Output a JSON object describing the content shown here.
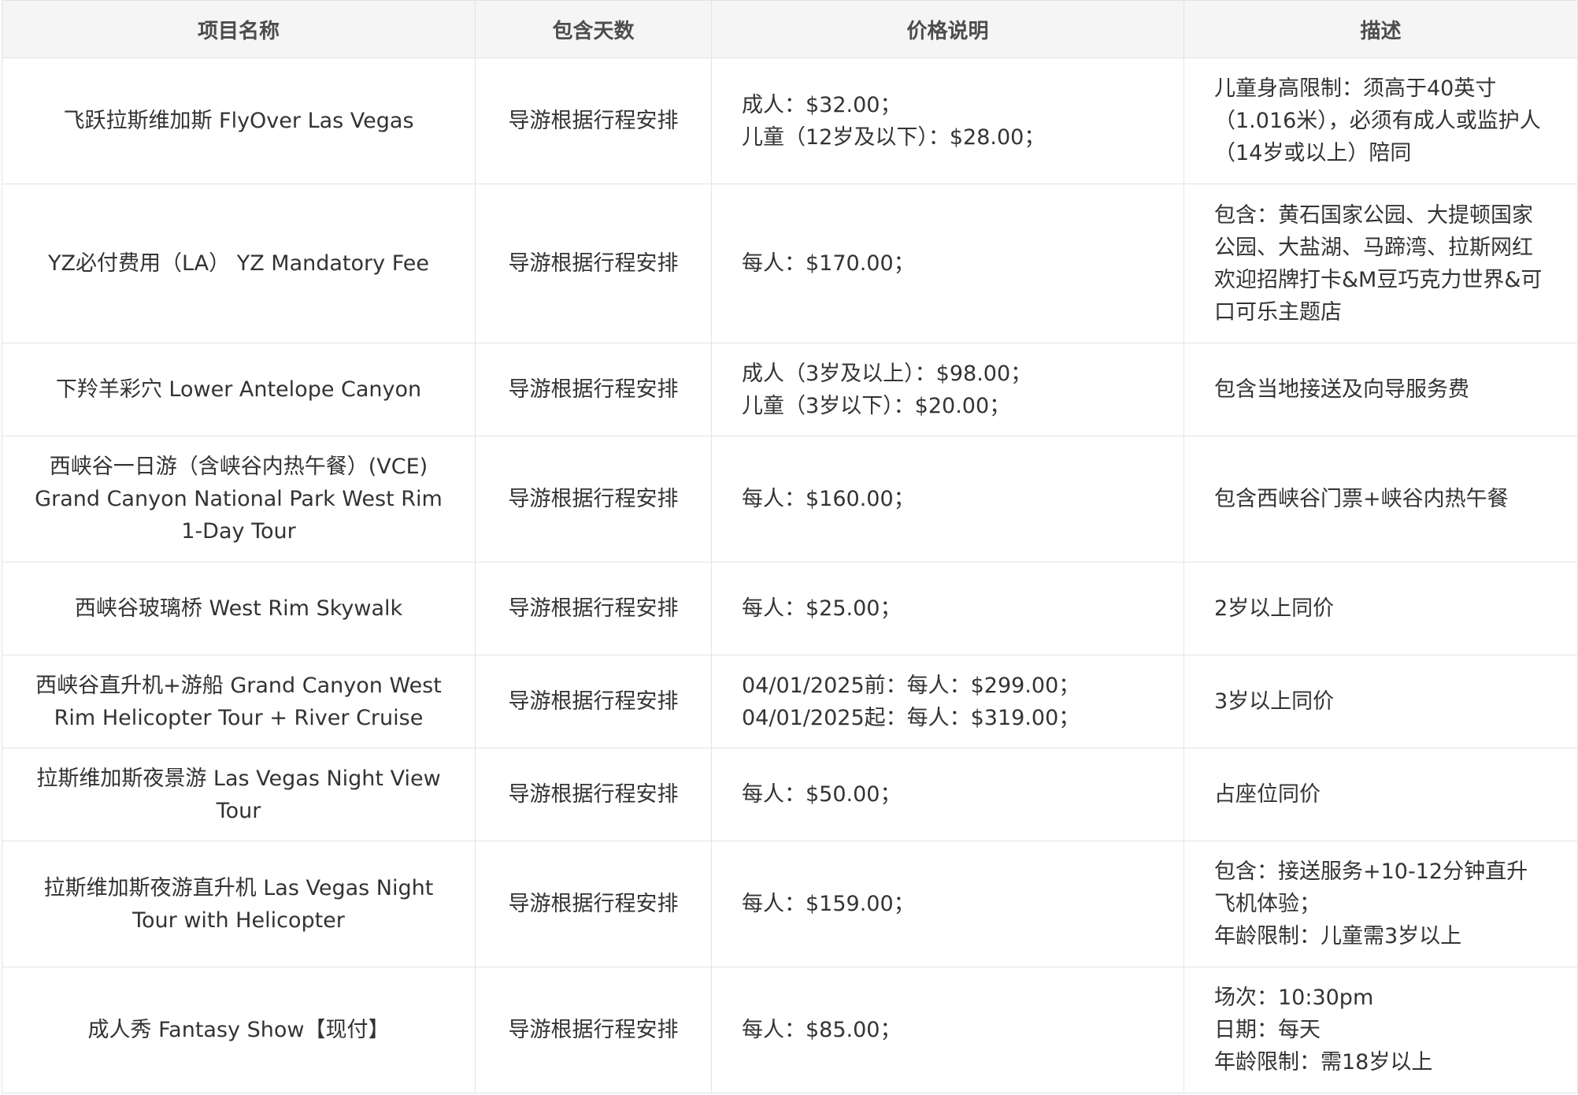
{
  "table": {
    "headers": [
      "项目名称",
      "包含天数",
      "价格说明",
      "描述"
    ],
    "rows": [
      {
        "name": "飞跃拉斯维加斯 FlyOver Las Vegas",
        "days": "导游根据行程安排",
        "price": [
          "成人：$32.00；",
          "儿童（12岁及以下）：$28.00；"
        ],
        "desc": [
          "儿童身高限制：须高于40英寸（1.016米），必须有成人或监护人（14岁或以上）陪同"
        ]
      },
      {
        "name": "YZ必付费用（LA） YZ Mandatory Fee",
        "days": "导游根据行程安排",
        "price": [
          "每人：$170.00；"
        ],
        "desc": [
          "包含：黄石国家公园、大提顿国家公园、大盐湖、马蹄湾、拉斯网红欢迎招牌打卡&M豆巧克力世界&可口可乐主题店"
        ]
      },
      {
        "name": "下羚羊彩穴 Lower Antelope Canyon",
        "days": "导游根据行程安排",
        "price": [
          "成人（3岁及以上）：$98.00；",
          "儿童（3岁以下）：$20.00；"
        ],
        "desc": [
          "包含当地接送及向导服务费"
        ]
      },
      {
        "name": "西峡谷一日游（含峡谷内热午餐）(VCE) Grand Canyon National Park West Rim 1-Day Tour",
        "days": "导游根据行程安排",
        "price": [
          "每人：$160.00；"
        ],
        "desc": [
          "包含西峡谷门票+峡谷内热午餐"
        ]
      },
      {
        "name": "西峡谷玻璃桥 West Rim Skywalk",
        "days": "导游根据行程安排",
        "price": [
          "每人：$25.00；"
        ],
        "desc": [
          "2岁以上同价"
        ]
      },
      {
        "name": "西峡谷直升机+游船 Grand Canyon West Rim Helicopter Tour + River Cruise",
        "days": "导游根据行程安排",
        "price": [
          "04/01/2025前：每人：$299.00；",
          "04/01/2025起：每人：$319.00；"
        ],
        "desc": [
          "3岁以上同价"
        ]
      },
      {
        "name": "拉斯维加斯夜景游 Las Vegas Night View Tour",
        "days": "导游根据行程安排",
        "price": [
          "每人：$50.00；"
        ],
        "desc": [
          "占座位同价"
        ]
      },
      {
        "name": "拉斯维加斯夜游直升机 Las Vegas Night Tour with Helicopter",
        "days": "导游根据行程安排",
        "price": [
          "每人：$159.00；"
        ],
        "desc": [
          "包含：接送服务+10-12分钟直升飞机体验；",
          "年龄限制：儿童需3岁以上"
        ]
      },
      {
        "name": "成人秀 Fantasy Show【现付】",
        "days": "导游根据行程安排",
        "price": [
          "每人：$85.00；"
        ],
        "desc": [
          "场次：10:30pm",
          "日期：每天",
          "年龄限制：需18岁以上"
        ]
      }
    ]
  }
}
